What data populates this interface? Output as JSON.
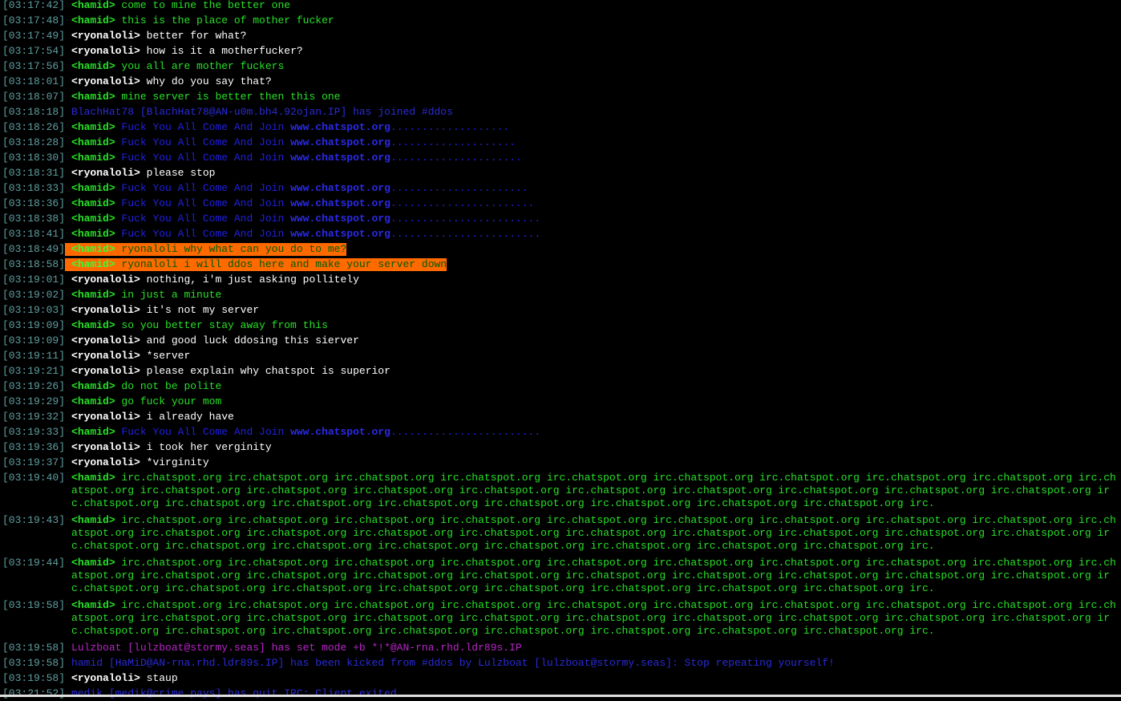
{
  "window": {
    "channel": "#ddos"
  },
  "colors": {
    "background": "#000000",
    "timestamp": "#5f9ea0",
    "nick_ryonaloli": "#ffffff",
    "nick_hamid": "#27e127",
    "spam_blue": "#2020e0",
    "highlight": "#ff6a00",
    "event_magenta": "#b526c6"
  },
  "log": [
    {
      "ts": "[03:17:42]",
      "nick": "<hamid>",
      "nick_color": "green",
      "parts": [
        {
          "t": " come to mine the better one",
          "c": "green"
        }
      ]
    },
    {
      "ts": "[03:17:48]",
      "nick": "<hamid>",
      "nick_color": "green",
      "parts": [
        {
          "t": " this is the place of mother fucker",
          "c": "green"
        }
      ]
    },
    {
      "ts": "[03:17:49]",
      "nick": "<ryonaloli>",
      "nick_color": "white",
      "parts": [
        {
          "t": " better for what?",
          "c": "white"
        }
      ]
    },
    {
      "ts": "[03:17:54]",
      "nick": "<ryonaloli>",
      "nick_color": "white",
      "parts": [
        {
          "t": " how is it a motherfucker?",
          "c": "white"
        }
      ]
    },
    {
      "ts": "[03:17:56]",
      "nick": "<hamid>",
      "nick_color": "green",
      "parts": [
        {
          "t": " you all are mother fuckers",
          "c": "green"
        }
      ]
    },
    {
      "ts": "[03:18:01]",
      "nick": "<ryonaloli>",
      "nick_color": "white",
      "parts": [
        {
          "t": " why do you say that?",
          "c": "white"
        }
      ]
    },
    {
      "ts": "[03:18:07]",
      "nick": "<hamid>",
      "nick_color": "green",
      "parts": [
        {
          "t": " mine server is better then this one",
          "c": "green"
        }
      ]
    },
    {
      "ts": "[03:18:18]",
      "nick": "",
      "nick_color": "",
      "parts": [
        {
          "t": "BlachHat78 [BlachHat78@AN-u0m.bh4.92ojan.IP] has joined #ddos",
          "c": "event-blue"
        }
      ]
    },
    {
      "ts": "[03:18:26]",
      "nick": "<hamid>",
      "nick_color": "green",
      "parts": [
        {
          "t": " Fuck You All Come And Join ",
          "c": "blue"
        },
        {
          "t": "www.chatspot.org",
          "c": "link"
        },
        {
          "t": "...................",
          "c": "blue"
        }
      ]
    },
    {
      "ts": "[03:18:28]",
      "nick": "<hamid>",
      "nick_color": "green",
      "parts": [
        {
          "t": " Fuck You All Come And Join ",
          "c": "blue"
        },
        {
          "t": "www.chatspot.org",
          "c": "link"
        },
        {
          "t": "....................",
          "c": "blue"
        }
      ]
    },
    {
      "ts": "[03:18:30]",
      "nick": "<hamid>",
      "nick_color": "green",
      "parts": [
        {
          "t": " Fuck You All Come And Join ",
          "c": "blue"
        },
        {
          "t": "www.chatspot.org",
          "c": "link"
        },
        {
          "t": ".....................",
          "c": "blue"
        }
      ]
    },
    {
      "ts": "[03:18:31]",
      "nick": "<ryonaloli>",
      "nick_color": "white",
      "parts": [
        {
          "t": " please stop",
          "c": "white"
        }
      ]
    },
    {
      "ts": "[03:18:33]",
      "nick": "<hamid>",
      "nick_color": "green",
      "parts": [
        {
          "t": " Fuck You All Come And Join ",
          "c": "blue"
        },
        {
          "t": "www.chatspot.org",
          "c": "link"
        },
        {
          "t": "......................",
          "c": "blue"
        }
      ]
    },
    {
      "ts": "[03:18:36]",
      "nick": "<hamid>",
      "nick_color": "green",
      "parts": [
        {
          "t": " Fuck You All Come And Join ",
          "c": "blue"
        },
        {
          "t": "www.chatspot.org",
          "c": "link"
        },
        {
          "t": ".......................",
          "c": "blue"
        }
      ]
    },
    {
      "ts": "[03:18:38]",
      "nick": "<hamid>",
      "nick_color": "green",
      "parts": [
        {
          "t": " Fuck You All Come And Join ",
          "c": "blue"
        },
        {
          "t": "www.chatspot.org",
          "c": "link"
        },
        {
          "t": "........................",
          "c": "blue"
        }
      ]
    },
    {
      "ts": "[03:18:41]",
      "nick": "<hamid>",
      "nick_color": "green",
      "parts": [
        {
          "t": " Fuck You All Come And Join ",
          "c": "blue"
        },
        {
          "t": "www.chatspot.org",
          "c": "link"
        },
        {
          "t": "........................",
          "c": "blue"
        }
      ]
    },
    {
      "ts": "[03:18:49]",
      "nick": "<hamid>",
      "nick_color": "green",
      "highlight": true,
      "parts": [
        {
          "t": " ryonaloli why what can you do to me?",
          "c": "green"
        }
      ]
    },
    {
      "ts": "[03:18:58]",
      "nick": "<hamid>",
      "nick_color": "green",
      "highlight": true,
      "parts": [
        {
          "t": " ryonaloli i will ddos here and make your server down",
          "c": "green"
        }
      ]
    },
    {
      "ts": "[03:19:01]",
      "nick": "<ryonaloli>",
      "nick_color": "white",
      "parts": [
        {
          "t": " nothing, i'm just asking pollitely",
          "c": "white"
        }
      ]
    },
    {
      "ts": "[03:19:02]",
      "nick": "<hamid>",
      "nick_color": "green",
      "parts": [
        {
          "t": " in just a minute",
          "c": "green"
        }
      ]
    },
    {
      "ts": "[03:19:03]",
      "nick": "<ryonaloli>",
      "nick_color": "white",
      "parts": [
        {
          "t": " it's not my server",
          "c": "white"
        }
      ]
    },
    {
      "ts": "[03:19:09]",
      "nick": "<hamid>",
      "nick_color": "green",
      "parts": [
        {
          "t": " so you better stay away from this",
          "c": "green"
        }
      ]
    },
    {
      "ts": "[03:19:09]",
      "nick": "<ryonaloli>",
      "nick_color": "white",
      "parts": [
        {
          "t": " and good luck ddosing this sierver",
          "c": "white"
        }
      ]
    },
    {
      "ts": "[03:19:11]",
      "nick": "<ryonaloli>",
      "nick_color": "white",
      "parts": [
        {
          "t": " *server",
          "c": "white"
        }
      ]
    },
    {
      "ts": "[03:19:21]",
      "nick": "<ryonaloli>",
      "nick_color": "white",
      "parts": [
        {
          "t": " please explain why chatspot is superior",
          "c": "white"
        }
      ]
    },
    {
      "ts": "[03:19:26]",
      "nick": "<hamid>",
      "nick_color": "green",
      "parts": [
        {
          "t": " do not be polite",
          "c": "green"
        }
      ]
    },
    {
      "ts": "[03:19:29]",
      "nick": "<hamid>",
      "nick_color": "green",
      "parts": [
        {
          "t": " go fuck your mom",
          "c": "green"
        }
      ]
    },
    {
      "ts": "[03:19:32]",
      "nick": "<ryonaloli>",
      "nick_color": "white",
      "parts": [
        {
          "t": " i already have",
          "c": "white"
        }
      ]
    },
    {
      "ts": "[03:19:33]",
      "nick": "<hamid>",
      "nick_color": "green",
      "parts": [
        {
          "t": " Fuck You All Come And Join ",
          "c": "blue"
        },
        {
          "t": "www.chatspot.org",
          "c": "link"
        },
        {
          "t": "........................",
          "c": "blue"
        }
      ]
    },
    {
      "ts": "[03:19:36]",
      "nick": "<ryonaloli>",
      "nick_color": "white",
      "parts": [
        {
          "t": " i took her verginity",
          "c": "white"
        }
      ]
    },
    {
      "ts": "[03:19:37]",
      "nick": "<ryonaloli>",
      "nick_color": "white",
      "parts": [
        {
          "t": " *virginity",
          "c": "white"
        }
      ]
    },
    {
      "ts": "[03:19:40]",
      "nick": "<hamid>",
      "nick_color": "green",
      "multi": true,
      "parts": [
        {
          "t": " irc.chatspot.org irc.chatspot.org irc.chatspot.org irc.chatspot.org irc.chatspot.org irc.chatspot.org irc.chatspot.org irc.chatspot.org irc.chatspot.org irc.chatspot.org irc.chatspot.org irc.chatspot.org irc.chatspot.org irc.chatspot.org irc.chatspot.org irc.chatspot.org irc.chatspot.org irc.chatspot.org irc.chatspot.org irc.chatspot.org irc.chatspot.org irc.chatspot.org irc.chatspot.org irc.chatspot.org irc.chatspot.org irc.chatspot.org irc.chatspot.org irc.",
          "c": "green"
        }
      ]
    },
    {
      "ts": "[03:19:43]",
      "nick": "<hamid>",
      "nick_color": "green",
      "multi": true,
      "parts": [
        {
          "t": " irc.chatspot.org irc.chatspot.org irc.chatspot.org irc.chatspot.org irc.chatspot.org irc.chatspot.org irc.chatspot.org irc.chatspot.org irc.chatspot.org irc.chatspot.org irc.chatspot.org irc.chatspot.org irc.chatspot.org irc.chatspot.org irc.chatspot.org irc.chatspot.org irc.chatspot.org irc.chatspot.org irc.chatspot.org irc.chatspot.org irc.chatspot.org irc.chatspot.org irc.chatspot.org irc.chatspot.org irc.chatspot.org irc.chatspot.org irc.chatspot.org irc.",
          "c": "green"
        }
      ]
    },
    {
      "ts": "[03:19:44]",
      "nick": "<hamid>",
      "nick_color": "green",
      "multi": true,
      "parts": [
        {
          "t": " irc.chatspot.org irc.chatspot.org irc.chatspot.org irc.chatspot.org irc.chatspot.org irc.chatspot.org irc.chatspot.org irc.chatspot.org irc.chatspot.org irc.chatspot.org irc.chatspot.org irc.chatspot.org irc.chatspot.org irc.chatspot.org irc.chatspot.org irc.chatspot.org irc.chatspot.org irc.chatspot.org irc.chatspot.org irc.chatspot.org irc.chatspot.org irc.chatspot.org irc.chatspot.org irc.chatspot.org irc.chatspot.org irc.chatspot.org irc.chatspot.org irc.",
          "c": "green"
        }
      ]
    },
    {
      "ts": "[03:19:58]",
      "nick": "<hamid>",
      "nick_color": "green",
      "multi": true,
      "parts": [
        {
          "t": " irc.chatspot.org irc.chatspot.org irc.chatspot.org irc.chatspot.org irc.chatspot.org irc.chatspot.org irc.chatspot.org irc.chatspot.org irc.chatspot.org irc.chatspot.org irc.chatspot.org irc.chatspot.org irc.chatspot.org irc.chatspot.org irc.chatspot.org irc.chatspot.org irc.chatspot.org irc.chatspot.org irc.chatspot.org irc.chatspot.org irc.chatspot.org irc.chatspot.org irc.chatspot.org irc.chatspot.org irc.chatspot.org irc.chatspot.org irc.chatspot.org irc.",
          "c": "green"
        }
      ]
    },
    {
      "ts": "[03:19:58]",
      "nick": "",
      "nick_color": "",
      "parts": [
        {
          "t": "Lulzboat [lulzboat@stormy.seas] has set mode +b *!*@AN-rna.rhd.ldr89s.IP",
          "c": "event-magenta"
        }
      ]
    },
    {
      "ts": "[03:19:58]",
      "nick": "",
      "nick_color": "",
      "parts": [
        {
          "t": "hamid [HaMiD@AN-rna.rhd.ldr89s.IP] has been kicked from #ddos by Lulzboat [lulzboat@stormy.seas]: Stop repeating yourself!",
          "c": "event-blue"
        }
      ]
    },
    {
      "ts": "[03:19:58]",
      "nick": "<ryonaloli>",
      "nick_color": "white",
      "parts": [
        {
          "t": " staup",
          "c": "white"
        }
      ]
    },
    {
      "ts": "[03:21:52]",
      "nick": "",
      "nick_color": "",
      "parts": [
        {
          "t": "medik [medik@crime.pays] has quit IRC: Client exited",
          "c": "event-blue"
        }
      ]
    }
  ]
}
